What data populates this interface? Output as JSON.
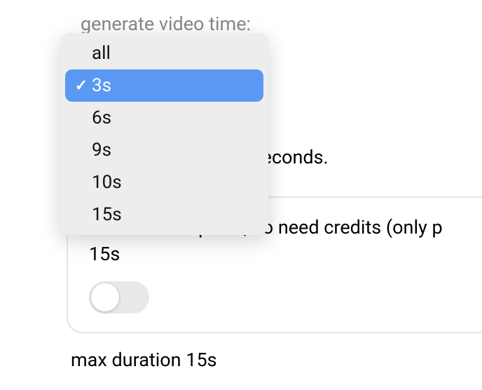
{
  "video_time": {
    "label": "generate video time:",
    "options": [
      "all",
      "3s",
      "6s",
      "9s",
      "10s",
      "15s"
    ],
    "selected_index": 1
  },
  "credits_line_fragment": "ts every seconds.",
  "relax_queue": {
    "line1_fragment": "add to relax queue, no need credits (only p",
    "line2": "15s",
    "enabled": false
  },
  "footer": "max duration 15s"
}
